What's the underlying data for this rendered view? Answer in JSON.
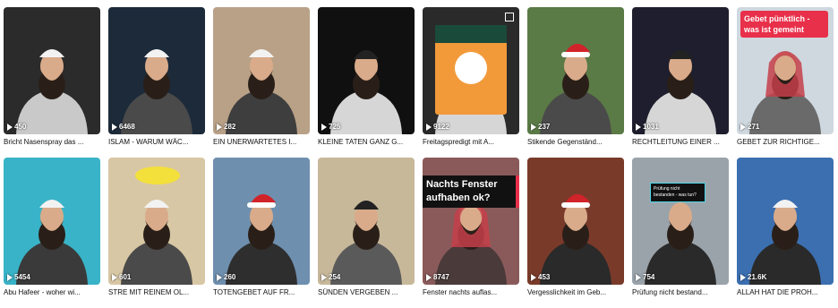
{
  "tiles": [
    {
      "caption": "Bricht Nasenspray das ...",
      "views": "450",
      "bg": "#2b2b2b",
      "hat": "white",
      "robe": "#c9c9c9"
    },
    {
      "caption": "ISLAM - WARUM WÄC...",
      "views": "6468",
      "bg": "#1c2a3a",
      "hat": "white",
      "robe": "#4a4a4a"
    },
    {
      "caption": "EIN UNERWARTETES I...",
      "views": "282",
      "bg": "#b9a187",
      "hat": "white",
      "robe": "#3e3e3e"
    },
    {
      "caption": "KLEINE TATEN GANZ G...",
      "views": "725",
      "bg": "#101010",
      "hat": "dark",
      "robe": "#d6d6d6"
    },
    {
      "caption": "Freitagspredigt mit A...",
      "views": "9122",
      "bg": "#2a2a2a",
      "hat": "none",
      "robe": "#d6d6d6",
      "poster": true
    },
    {
      "caption": "Stikende Gegenständ...",
      "views": "237",
      "bg": "#5a7a46",
      "hat": "santa",
      "robe": "#4a4a4a"
    },
    {
      "caption": "RECHTLEITUNG EINER ...",
      "views": "1031",
      "bg": "#1e1e2e",
      "hat": "dark",
      "robe": "#d6d6d6"
    },
    {
      "caption": "GEBET ZUR RICHTIGE...",
      "views": "271",
      "bg": "#cfd8df",
      "hat": "red-scarf",
      "robe": "#6a6a6a",
      "overlay_red": "Gebet pünktlich - was ist gemeint"
    },
    {
      "caption": "Abu Hafeer - woher wi...",
      "views": "5454",
      "bg": "#39b3c7",
      "hat": "white",
      "robe": "#3a3a3a"
    },
    {
      "caption": "STRE MIT REINEM OL...",
      "views": "601",
      "bg": "#d8c7a4",
      "hat": "white",
      "robe": "#4a4a4a",
      "bubble": true
    },
    {
      "caption": "TOTENGEBET AUF FR...",
      "views": "260",
      "bg": "#6f8fae",
      "hat": "santa",
      "robe": "#2e2e2e"
    },
    {
      "caption": "SÜNDEN VERGEBEN ...",
      "views": "254",
      "bg": "#c7b89a",
      "hat": "dark",
      "robe": "#5a5a5a"
    },
    {
      "caption": "Fenster nachts auflas...",
      "views": "8747",
      "bg": "#8a5a5a",
      "hat": "red-scarf",
      "robe": "#4a3a3a",
      "overlay_dark": "Nachts Fenster aufhaben ok?"
    },
    {
      "caption": "Vergesslichkeit im Geb...",
      "views": "453",
      "bg": "#7a3a2a",
      "hat": "santa",
      "robe": "#2a2a2a"
    },
    {
      "caption": "Prüfung nicht bestand...",
      "views": "754",
      "bg": "#9aa3aa",
      "hat": "none",
      "robe": "#2a2a2a",
      "overlay_small": "Prüfung nicht bestanden - was tun?"
    },
    {
      "caption": "ALLAH HAT DIE PROH...",
      "views": "21.6K",
      "bg": "#3b6fb0",
      "hat": "white",
      "robe": "#2a2a2a"
    }
  ]
}
